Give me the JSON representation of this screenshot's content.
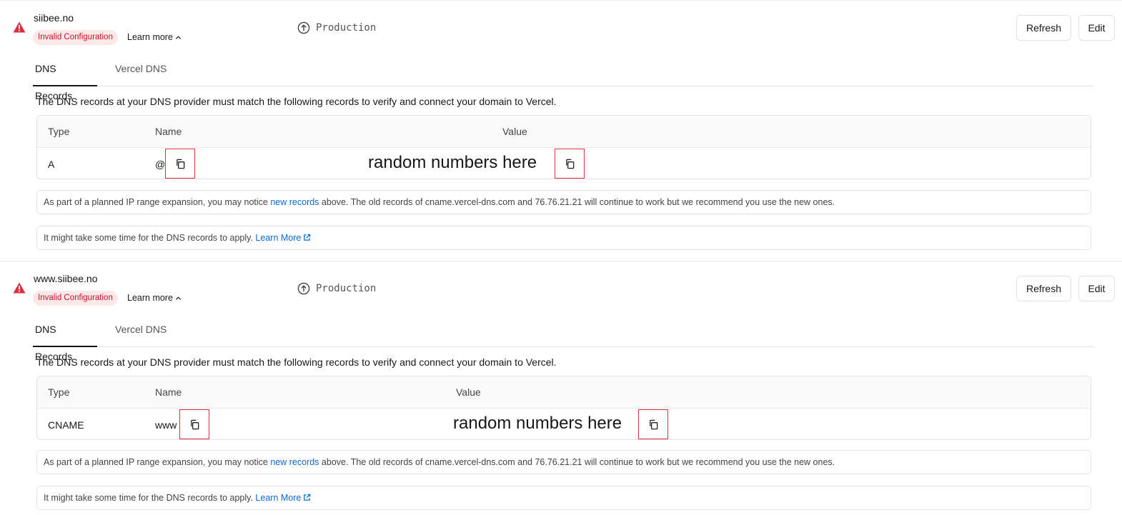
{
  "colors": {
    "error": "#c8102e",
    "badge_bg": "#fde8e8",
    "link": "#0a6ad6",
    "copy_highlight": "#e0313f"
  },
  "domains": [
    {
      "name": "siibee.no",
      "status_badge": "Invalid Configuration",
      "learn_more": "Learn more",
      "environment": "Production",
      "refresh_label": "Refresh",
      "edit_label": "Edit",
      "tabs": [
        "DNS Records",
        "Vercel DNS"
      ],
      "description": "The DNS records at your DNS provider must match the following records to verify and connect your domain to Vercel.",
      "table": {
        "headers": [
          "Type",
          "Name",
          "Value"
        ],
        "rows": [
          {
            "type": "A",
            "name": "@",
            "value": "random numbers here"
          }
        ]
      },
      "note1": {
        "before": "As part of a planned IP range expansion, you may notice ",
        "link": "new records",
        "after": " above. The old records of cname.vercel-dns.com and 76.76.21.21 will continue to work but we recommend you use the new ones."
      },
      "note2": {
        "before": "It might take some time for the DNS records to apply. ",
        "link": "Learn More"
      }
    },
    {
      "name": "www.siibee.no",
      "status_badge": "Invalid Configuration",
      "learn_more": "Learn more",
      "environment": "Production",
      "refresh_label": "Refresh",
      "edit_label": "Edit",
      "tabs": [
        "DNS Records",
        "Vercel DNS"
      ],
      "description": "The DNS records at your DNS provider must match the following records to verify and connect your domain to Vercel.",
      "table": {
        "headers": [
          "Type",
          "Name",
          "Value"
        ],
        "rows": [
          {
            "type": "CNAME",
            "name": "www",
            "value": "random numbers here"
          }
        ]
      },
      "note1": {
        "before": "As part of a planned IP range expansion, you may notice ",
        "link": "new records",
        "after": " above. The old records of cname.vercel-dns.com and 76.76.21.21 will continue to work but we recommend you use the new ones."
      },
      "note2": {
        "before": "It might take some time for the DNS records to apply. ",
        "link": "Learn More"
      }
    }
  ]
}
